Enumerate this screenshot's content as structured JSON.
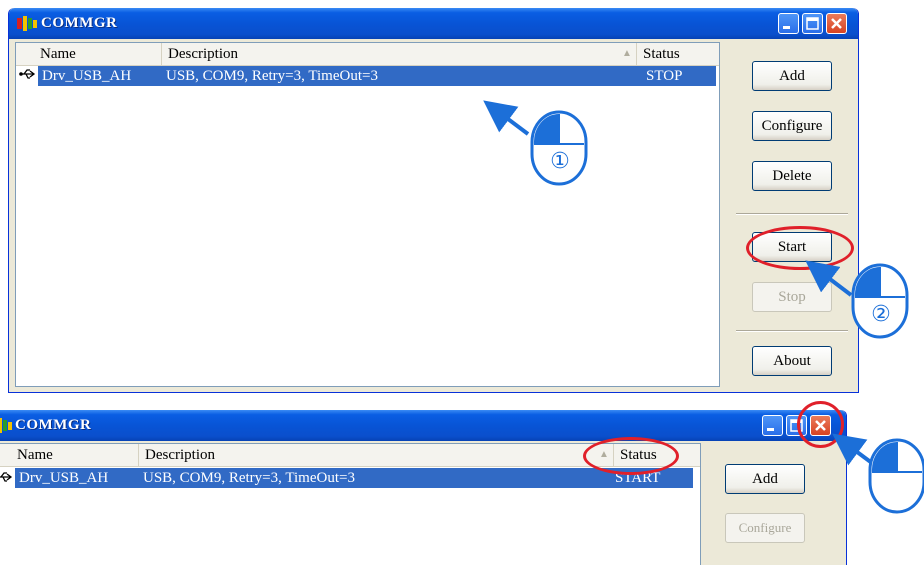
{
  "windows": [
    {
      "title": "COMMGR",
      "columns": {
        "name": "Name",
        "description": "Description",
        "status": "Status"
      },
      "row": {
        "name": "Drv_USB_AH",
        "description": "USB, COM9, Retry=3, TimeOut=3",
        "status": "STOP"
      },
      "buttons": {
        "add": "Add",
        "configure": "Configure",
        "delete": "Delete",
        "start": "Start",
        "stop": "Stop",
        "about": "About"
      }
    },
    {
      "title": "COMMGR",
      "columns": {
        "name": "Name",
        "description": "Description",
        "status": "Status"
      },
      "row": {
        "name": "Drv_USB_AH",
        "description": "USB, COM9, Retry=3, TimeOut=3",
        "status": "START"
      },
      "buttons": {
        "add": "Add",
        "configure": "Configure"
      }
    }
  ],
  "callouts": {
    "step1": "①",
    "step2": "②"
  },
  "colors": {
    "title_bar": "#0a5ee3",
    "selection": "#316ac5",
    "highlight_ring": "#e0202a",
    "arrow": "#1c6fd8"
  }
}
